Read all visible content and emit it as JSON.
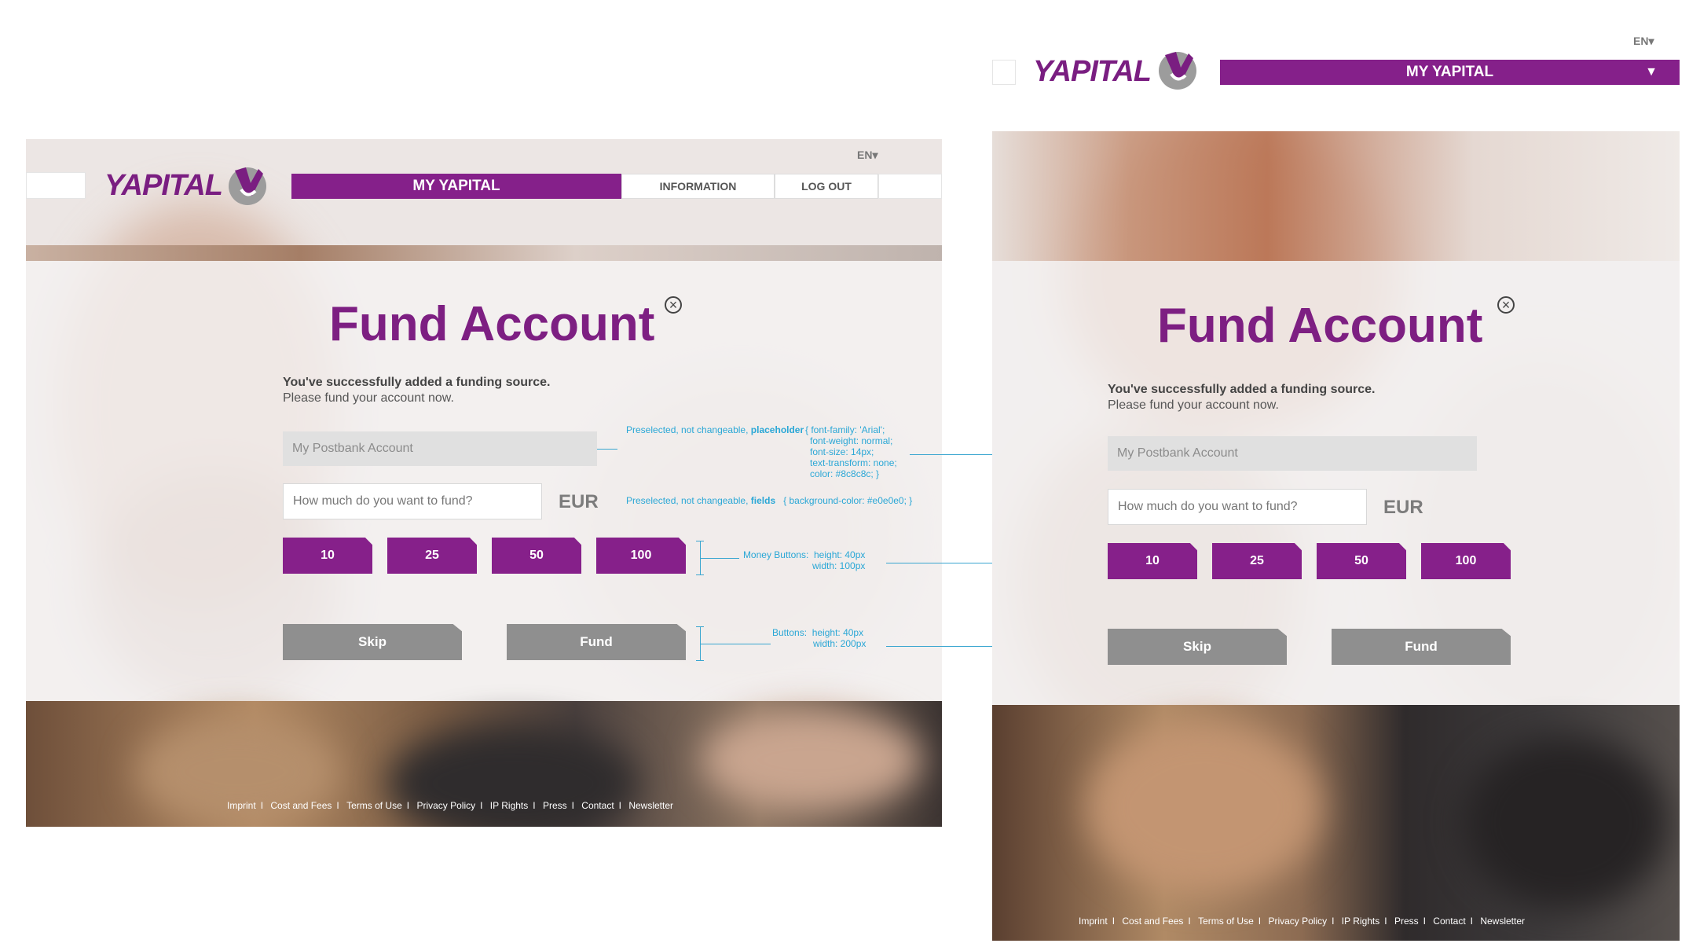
{
  "lang": "EN",
  "logo": "YAPITAL",
  "nav": {
    "main": "MY YAPITAL",
    "info": "INFORMATION",
    "logout": "LOG OUT"
  },
  "content": {
    "title": "Fund Account",
    "message_bold": "You've successfully added a funding source.",
    "message": "Please fund your account now.",
    "account_value": "My Postbank Account",
    "amount_placeholder": "How much do you want to fund?",
    "currency": "EUR",
    "amounts": [
      "10",
      "25",
      "50",
      "100"
    ],
    "skip_label": "Skip",
    "fund_label": "Fund"
  },
  "footer": [
    "Imprint",
    "Cost and Fees",
    "Terms of Use",
    "Privacy Policy",
    "IP Rights",
    "Press",
    "Contact",
    "Newsletter"
  ],
  "annotations": {
    "placeholder_prefix": "Preselected, not changeable,",
    "placeholder_key": "placeholder",
    "placeholder_css": [
      "{ font-family: 'Arial';",
      "font-weight: normal;",
      "font-size: 14px;",
      "text-transform: none;",
      "color: #8c8c8c; }"
    ],
    "fields_prefix": "Preselected, not changeable,",
    "fields_key": "fields",
    "fields_css": "{ background-color: #e0e0e0; }",
    "money_label": "Money Buttons:",
    "money_height": "height: 40px",
    "money_width": "width: 100px",
    "buttons_label": "Buttons:",
    "buttons_height": "height: 40px",
    "buttons_width": "width: 200px"
  },
  "colors": {
    "brand": "#85208a",
    "field_bg": "#e0e0e0",
    "placeholder": "#8c8c8c",
    "annotation": "#2aa7d6"
  }
}
